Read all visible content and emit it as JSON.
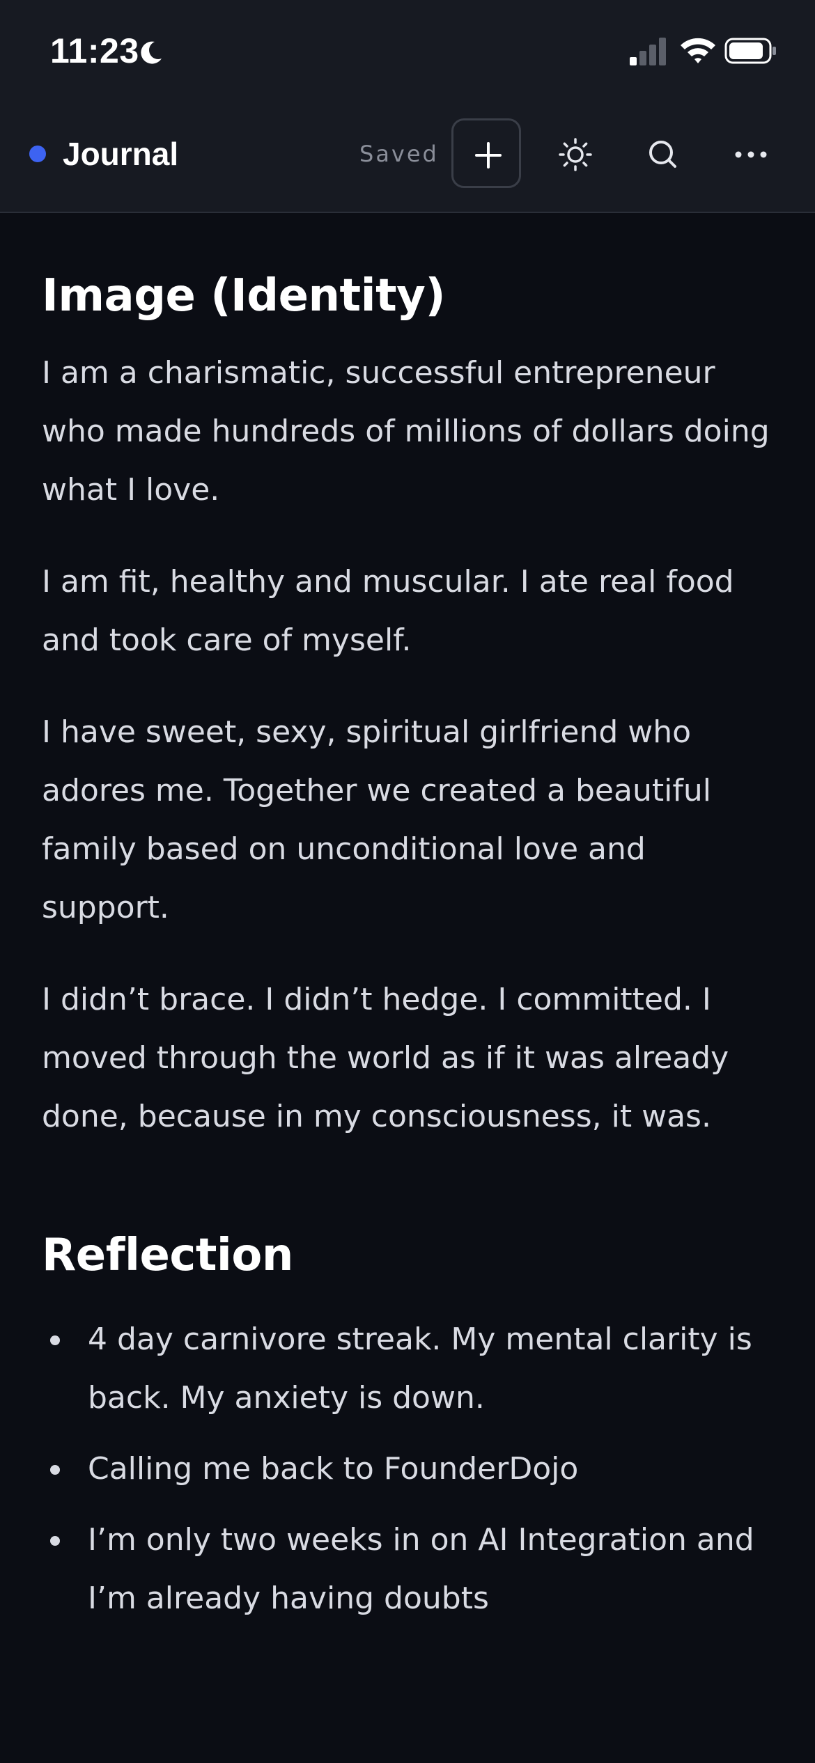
{
  "status_bar": {
    "time": "11:23",
    "icons": [
      "moon-icon",
      "cellular-signal-icon",
      "wifi-icon",
      "battery-icon"
    ]
  },
  "header": {
    "title": "Journal",
    "status": "Saved",
    "accent_color": "#3d63f2",
    "actions": [
      "plus-icon",
      "sun-icon",
      "search-icon",
      "more-horizontal-icon"
    ]
  },
  "sections": [
    {
      "heading": "Image (Identity)",
      "paragraphs": [
        "I am a charismatic, successful entrepreneur who made hundreds of millions of dollars doing what I love.",
        "I am fit, healthy and muscular. I ate real food and took care of myself.",
        "I have sweet, sexy, spiritual girlfriend who adores me. Together we created a beautiful family based on unconditional love and support.",
        "I didn’t brace. I didn’t hedge. I committed. I moved through the world as if it was already done, because in my consciousness, it was."
      ]
    },
    {
      "heading": "Reflection",
      "bullets": [
        "4 day carnivore streak. My mental clarity is back. My anxiety is down.",
        "Calling me back to FounderDojo",
        "I’m only two weeks in on AI Integration and I’m already having doubts"
      ]
    }
  ]
}
